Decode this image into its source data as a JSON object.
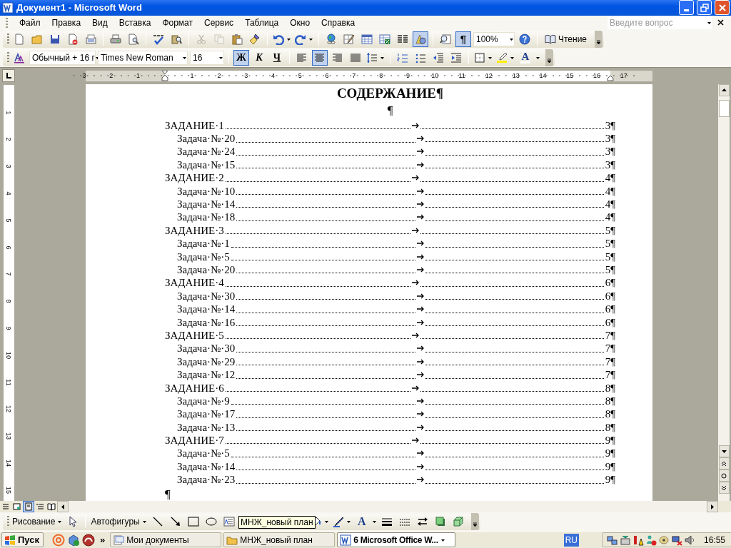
{
  "window": {
    "title": "Документ1 - Microsoft Word"
  },
  "menu": {
    "items": [
      "Файл",
      "Правка",
      "Вид",
      "Вставка",
      "Формат",
      "Сервис",
      "Таблица",
      "Окно",
      "Справка"
    ],
    "help_placeholder": "Введите вопрос"
  },
  "standard_toolbar": {
    "cut": {
      "disabled": true
    },
    "copy": {
      "disabled": true
    },
    "drawing": {
      "pressed": true
    },
    "formatting_marks": {
      "label": "¶",
      "pressed": true
    },
    "zoom": "100%",
    "reading": "Чтение"
  },
  "formatting_toolbar": {
    "style": "Обычный + 16 г",
    "font": "Times New Roman",
    "size": "16",
    "bold": {
      "label": "Ж",
      "pressed": true
    },
    "italic": {
      "label": "К",
      "pressed": false
    },
    "underline": {
      "label": "Ч",
      "pressed": false
    },
    "alignment": [
      {
        "selected": false
      },
      {
        "selected": true
      },
      {
        "selected": false
      },
      {
        "selected": false
      }
    ],
    "font_color_label": "A"
  },
  "ruler": {
    "left_labels": [
      "3",
      "2",
      "1"
    ],
    "right_labels": [
      "1",
      "2",
      "3",
      "4",
      "5",
      "6",
      "7",
      "8",
      "9",
      "10",
      "11",
      "12",
      "13",
      "14",
      "15",
      "16",
      "17"
    ]
  },
  "vertical_ruler": {
    "labels": [
      "1",
      "2",
      "3",
      "4",
      "5",
      "6",
      "7",
      "8",
      "9",
      "10",
      "11",
      "12",
      "13",
      "14",
      "15"
    ]
  },
  "document": {
    "heading": "СОДЕРЖАНИЕ¶",
    "after_heading": "¶",
    "end_mark": "¶",
    "sections": [
      {
        "title": "ЗАДАНИЕ·1",
        "page": "3¶",
        "children": [
          {
            "title": "Задача·№·20",
            "page": "3¶"
          },
          {
            "title": "Задача·№·24",
            "page": "3¶"
          },
          {
            "title": "Задача·№·15",
            "page": "3¶"
          }
        ]
      },
      {
        "title": "ЗАДАНИЕ·2",
        "page": "4¶",
        "children": [
          {
            "title": "Задача·№·10",
            "page": "4¶"
          },
          {
            "title": "Задача·№·14",
            "page": "4¶"
          },
          {
            "title": "Задача·№·18",
            "page": "4¶"
          }
        ]
      },
      {
        "title": "ЗАДАНИЕ·3",
        "page": "5¶",
        "children": [
          {
            "title": "Задача·№·1",
            "page": "5¶"
          },
          {
            "title": "Задача·№·5",
            "page": "5¶"
          },
          {
            "title": "Задача·№·20",
            "page": "5¶"
          }
        ]
      },
      {
        "title": "ЗАДАНИЕ·4",
        "page": "6¶",
        "children": [
          {
            "title": "Задача·№·30",
            "page": "6¶"
          },
          {
            "title": "Задача·№·14",
            "page": "6¶"
          },
          {
            "title": "Задача·№·16",
            "page": "6¶"
          }
        ]
      },
      {
        "title": "ЗАДАНИЕ·5",
        "page": "7¶",
        "children": [
          {
            "title": "Задача·№·30",
            "page": "7¶"
          },
          {
            "title": "Задача·№·29",
            "page": "7¶"
          },
          {
            "title": "Задача·№·12",
            "page": "7¶"
          }
        ]
      },
      {
        "title": "ЗАДАНИЕ·6",
        "page": "8¶",
        "children": [
          {
            "title": "Задача·№·9",
            "page": "8¶"
          },
          {
            "title": "Задача·№·17",
            "page": "8¶"
          },
          {
            "title": "Задача·№·13",
            "page": "8¶"
          }
        ]
      },
      {
        "title": "ЗАДАНИЕ·7",
        "page": "9¶",
        "children": [
          {
            "title": "Задача·№·5",
            "page": "9¶"
          },
          {
            "title": "Задача·№·14",
            "page": "9¶"
          },
          {
            "title": "Задача·№·23",
            "page": "9¶"
          }
        ]
      }
    ]
  },
  "views": [
    {
      "selected": false
    },
    {
      "selected": false
    },
    {
      "selected": true
    },
    {
      "selected": false
    },
    {
      "selected": false
    }
  ],
  "drawing_toolbar": {
    "drawing": "Рисование",
    "autoshapes": "Автофигуры",
    "font_color_label": "A",
    "tooltip": "МНЖ_новый план"
  },
  "taskbar": {
    "start": "Пуск",
    "more": "»",
    "tasks": [
      {
        "label": "Мои документы",
        "selected": false
      },
      {
        "label": "МНЖ_новый план",
        "selected": false
      },
      {
        "label": "6 Microsoft Office W...",
        "selected": true
      }
    ],
    "language": "RU",
    "clock": "16:55"
  }
}
